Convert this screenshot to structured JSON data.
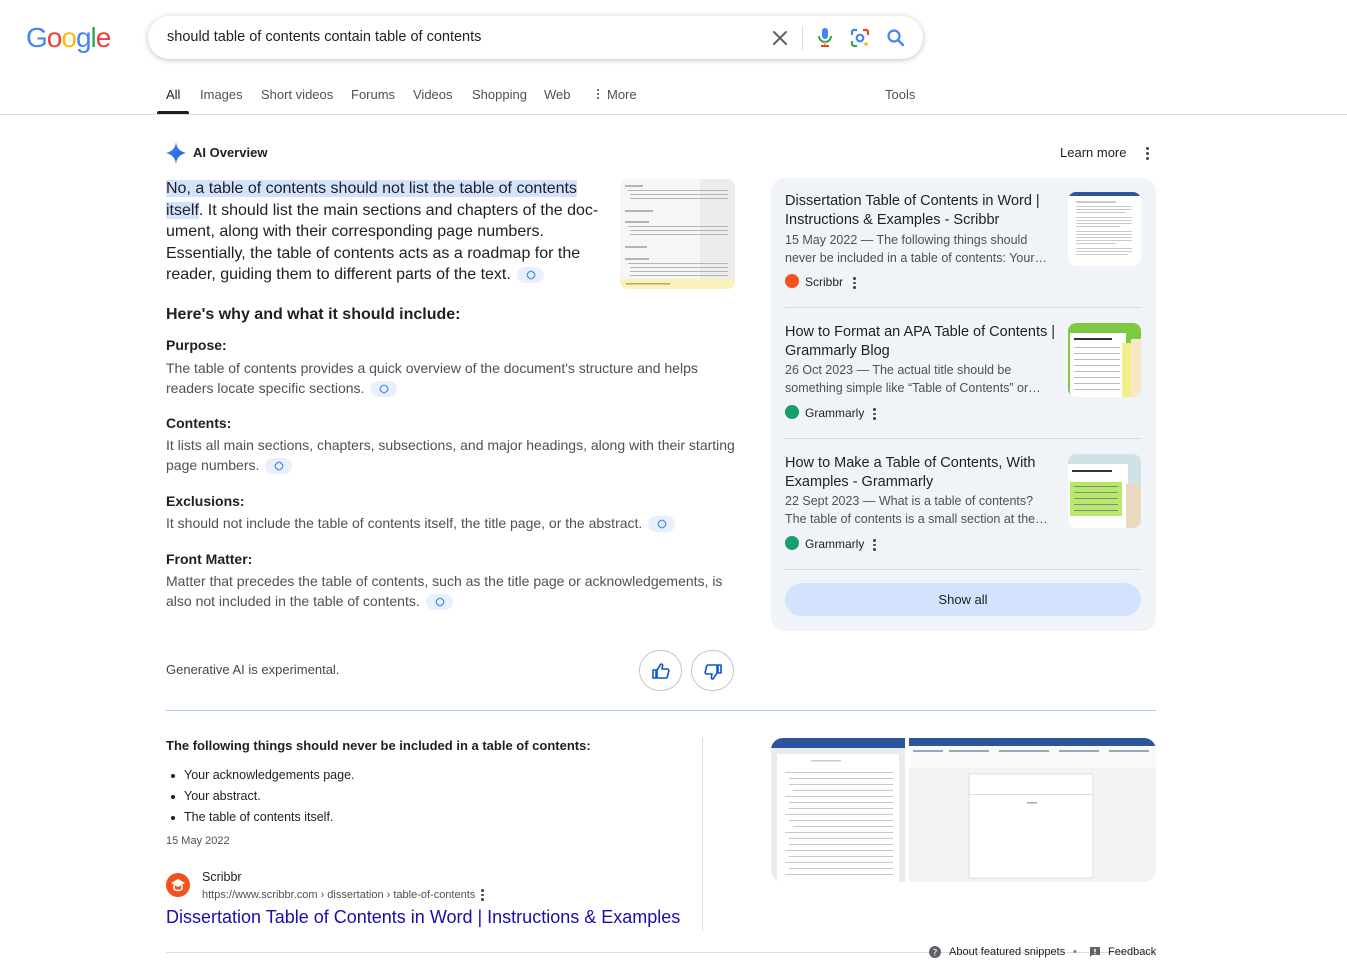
{
  "logo": {
    "letters": [
      "G",
      "o",
      "o",
      "g",
      "l",
      "e"
    ],
    "colors": [
      "#4285F4",
      "#EA4335",
      "#FBBC05",
      "#4285F4",
      "#34A853",
      "#EA4335"
    ]
  },
  "search": {
    "query": "should table of contents contain table of contents",
    "icons": [
      "close-icon",
      "mic-icon",
      "lens-icon",
      "search-icon"
    ]
  },
  "tabs": [
    {
      "label": "All",
      "active": true
    },
    {
      "label": "Images"
    },
    {
      "label": "Short videos"
    },
    {
      "label": "Forums"
    },
    {
      "label": "Videos"
    },
    {
      "label": "Shopping"
    },
    {
      "label": "Web"
    },
    {
      "label": "More"
    },
    {
      "label": "Tools"
    }
  ],
  "ai_overview": {
    "title": "AI Overview",
    "learn_more": "Learn more",
    "summary_highlight": "No, a table of contents should not list the table of contents itself",
    "summary_rest": ". It should list the main sections and chapters of the doc­ument, along with their corresponding page numbers. Essentially, the table of contents acts as a roadmap for the reader, guiding them to different parts of the text.",
    "subheading": "Here's why and what it should include:",
    "sections": [
      {
        "label": "Purpose:",
        "text": "The table of contents provides a quick overview of the document's structure and helps readers locate specific sections."
      },
      {
        "label": "Contents:",
        "text": "It lists all main sections, chapters, subsections, and major headings, along with their starting page numbers."
      },
      {
        "label": "Exclusions:",
        "text": "It should not include the table of contents itself, the title page, or the abstract."
      },
      {
        "label": "Front Matter:",
        "text": "Matter that precedes the table of contents, such as the title page or acknowledgements, is also not included in the table of contents."
      }
    ],
    "disclaimer": "Generative AI is experimental."
  },
  "sources": {
    "items": [
      {
        "title": "Dissertation Table of Contents in Word | Instructions & Examples - Scribbr",
        "snippet": "15 May 2022 — The following things should never be included in a table of contents: Your…",
        "site": "Scribbr",
        "favicon_color": "#f4511e"
      },
      {
        "title": "How to Format an APA Table of Contents | Grammarly Blog",
        "snippet": "26 Oct 2023 — The actual title should be something simple like “Table of Contents” or…",
        "site": "Grammarly",
        "favicon_color": "#15a06e"
      },
      {
        "title": "How to Make a Table of Contents, With Examples - Grammarly",
        "snippet": "22 Sept 2023 — What is a table of contents? The table of contents is a small section at the…",
        "site": "Grammarly",
        "favicon_color": "#15a06e"
      }
    ],
    "show_all": "Show all"
  },
  "featured_snippet": {
    "heading": "The following things should never be included in a table of contents:",
    "bullets": [
      "Your acknowledgements page.",
      "Your abstract.",
      "The table of contents itself."
    ],
    "date": "15 May 2022",
    "site": "Scribbr",
    "url": "https://www.scribbr.com › dissertation › table-of-contents",
    "link": "Dissertation Table of Contents in Word | Instructions & Examples"
  },
  "footer": {
    "about": "About featured snippets",
    "dot": "•",
    "feedback": "Feedback"
  }
}
